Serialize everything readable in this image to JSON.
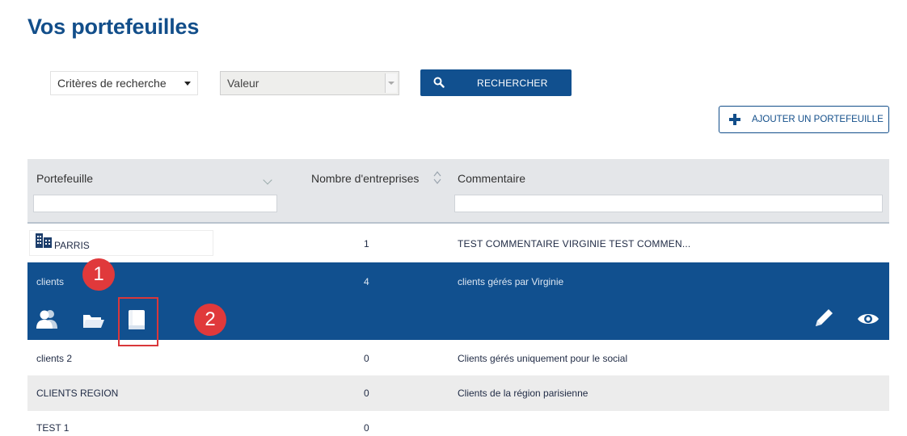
{
  "page": {
    "title": "Vos portefeuilles"
  },
  "search": {
    "criteria_label": "Critères de recherche",
    "value_placeholder": "Valeur",
    "button_label": "RECHERCHER"
  },
  "actions": {
    "add_label": "AJOUTER UN PORTEFEUILLE"
  },
  "table": {
    "headers": {
      "portefeuille": "Portefeuille",
      "nombre": "Nombre d'entreprises",
      "commentaire": "Commentaire"
    },
    "rows": [
      {
        "name": "PARRIS",
        "count": "1",
        "comment": "TEST COMMENTAIRE VIRGINIE TEST COMMEN..."
      },
      {
        "name": "clients",
        "count": "4",
        "comment": "clients gérés par Virginie"
      },
      {
        "name": "clients 2",
        "count": "0",
        "comment": "Clients gérés uniquement pour le social"
      },
      {
        "name": "CLIENTS REGION",
        "count": "0",
        "comment": "Clients de la région parisienne"
      },
      {
        "name": "TEST 1",
        "count": "0",
        "comment": ""
      }
    ]
  },
  "annotations": {
    "badge_1": "1",
    "badge_2": "2"
  },
  "colors": {
    "primary": "#11508f",
    "title": "#124e8a",
    "annotation": "#e0393b"
  },
  "icons": [
    "search-icon",
    "plus-icon",
    "building-icon",
    "users-icon",
    "folder-icon",
    "book-icon",
    "pencil-icon",
    "eye-icon"
  ]
}
